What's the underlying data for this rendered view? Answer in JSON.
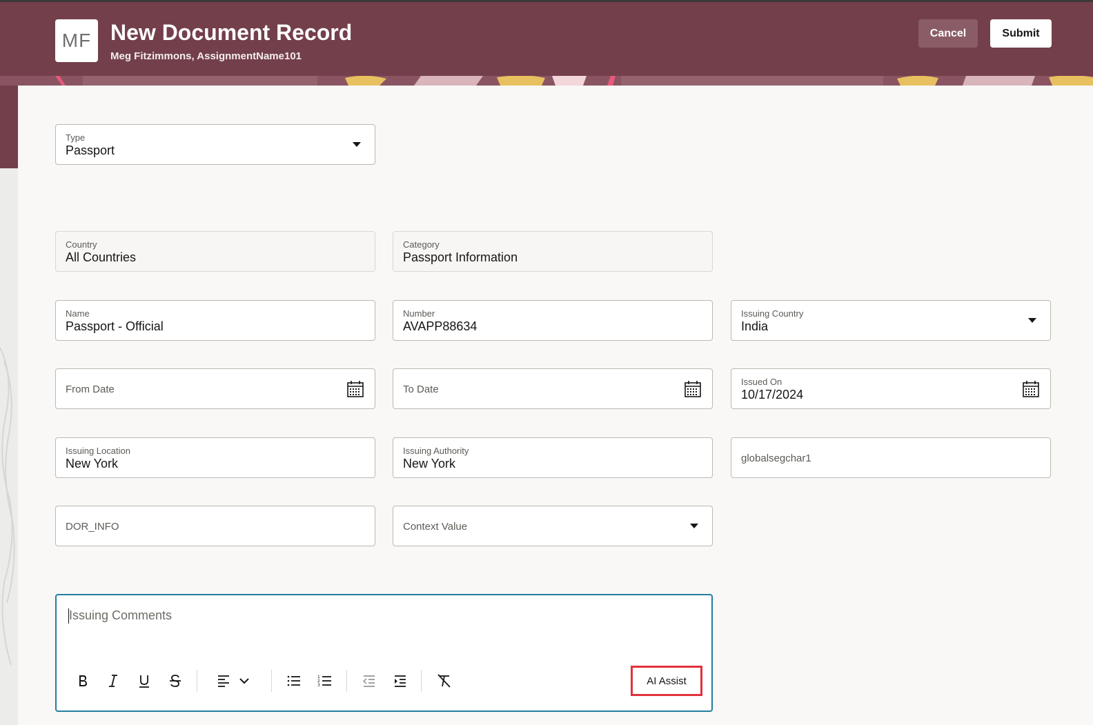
{
  "header": {
    "avatar_initials": "MF",
    "title": "New Document Record",
    "subtitle": "Meg Fitzimmons, AssignmentName101",
    "cancel_label": "Cancel",
    "submit_label": "Submit"
  },
  "form": {
    "type": {
      "label": "Type",
      "value": "Passport"
    },
    "country": {
      "label": "Country",
      "value": "All Countries"
    },
    "category": {
      "label": "Category",
      "value": "Passport Information"
    },
    "name": {
      "label": "Name",
      "value": "Passport - Official"
    },
    "number": {
      "label": "Number",
      "value": "AVAPP88634"
    },
    "issuing_country": {
      "label": "Issuing Country",
      "value": "India"
    },
    "from_date": {
      "placeholder": "From Date"
    },
    "to_date": {
      "placeholder": "To Date"
    },
    "issued_on": {
      "label": "Issued On",
      "value": "10/17/2024"
    },
    "issuing_location": {
      "label": "Issuing Location",
      "value": "New York"
    },
    "issuing_authority": {
      "label": "Issuing Authority",
      "value": "New York"
    },
    "globalsegchar1": {
      "placeholder": "globalsegchar1"
    },
    "dor_info": {
      "placeholder": "DOR_INFO"
    },
    "context_value": {
      "placeholder": "Context Value"
    }
  },
  "editor": {
    "placeholder": "Issuing Comments",
    "ai_assist_label": "AI Assist",
    "toolbar_icons": [
      "bold-icon",
      "italic-icon",
      "underline-icon",
      "strikethrough-icon",
      "align-left-icon",
      "chevron-down-icon",
      "bullet-list-icon",
      "numbered-list-icon",
      "outdent-icon",
      "indent-icon",
      "clear-formatting-icon"
    ]
  },
  "colors": {
    "header_bg": "#733f4b",
    "cancel_bg": "#8a5d66",
    "editor_focus": "#227e9e",
    "ai_highlight": "#e0323b"
  }
}
